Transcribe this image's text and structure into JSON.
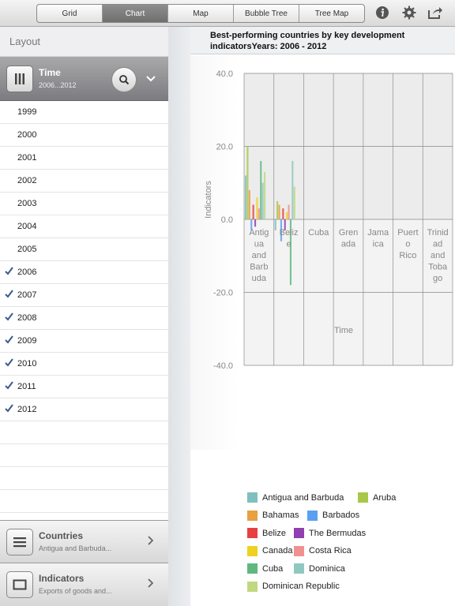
{
  "toolbar": {
    "tabs": [
      "Grid",
      "Chart",
      "Map",
      "Bubble Tree",
      "Tree Map"
    ],
    "active_tab": "Chart"
  },
  "sidebar": {
    "layout_label": "Layout",
    "time": {
      "title": "Time",
      "subtitle": "2006...2012"
    },
    "years": [
      {
        "label": "1999",
        "checked": false
      },
      {
        "label": "2000",
        "checked": false
      },
      {
        "label": "2001",
        "checked": false
      },
      {
        "label": "2002",
        "checked": false
      },
      {
        "label": "2003",
        "checked": false
      },
      {
        "label": "2004",
        "checked": false
      },
      {
        "label": "2005",
        "checked": false
      },
      {
        "label": "2006",
        "checked": true
      },
      {
        "label": "2007",
        "checked": true
      },
      {
        "label": "2008",
        "checked": true
      },
      {
        "label": "2009",
        "checked": true
      },
      {
        "label": "2010",
        "checked": true
      },
      {
        "label": "2011",
        "checked": true
      },
      {
        "label": "2012",
        "checked": true
      }
    ],
    "countries": {
      "title": "Countries",
      "subtitle": "Antigua and Barbuda..."
    },
    "indicators": {
      "title": "Indicators",
      "subtitle": "Exports of goods and..."
    }
  },
  "chart_data": {
    "type": "bar",
    "title": "Best-performing countries by key development indicatorsYears: 2006 - 2012",
    "xlabel": "Time",
    "ylabel": "Indicators",
    "ylim": [
      -40,
      40
    ],
    "yticks": [
      "40.0",
      "20.0",
      "0.0",
      "-20.0",
      "-40.0"
    ],
    "categories": [
      "Antigua and Barbuda",
      "Belize",
      "Cuba",
      "Grenada",
      "Jamaica",
      "Puerto Rico",
      "Trinidad and Tobago"
    ],
    "category_label_lines": [
      [
        "Antig",
        "ua",
        "and",
        "Barb",
        "uda"
      ],
      [
        "Beliz",
        "e"
      ],
      [
        "Cuba"
      ],
      [
        "Gren",
        "ada"
      ],
      [
        "Jama",
        "ica"
      ],
      [
        "Puert",
        "o",
        "Rico"
      ],
      [
        "Trinid",
        "ad",
        "and",
        "Toba",
        "go"
      ]
    ],
    "grid": true,
    "legend_position": "bottom",
    "series": [
      {
        "name": "Antigua and Barbuda",
        "color": "#7fbfbf",
        "values": [
          12,
          -3,
          0,
          0,
          0,
          0,
          0
        ]
      },
      {
        "name": "Aruba",
        "color": "#a8c84a",
        "values": [
          20,
          5,
          0,
          0,
          0,
          0,
          0
        ]
      },
      {
        "name": "Bahamas",
        "color": "#e8a040",
        "values": [
          8,
          4,
          0,
          0,
          0,
          0,
          0
        ]
      },
      {
        "name": "Barbados",
        "color": "#5aa0f0",
        "values": [
          -3,
          -6,
          0,
          0,
          0,
          0,
          0
        ]
      },
      {
        "name": "Belize",
        "color": "#e84040",
        "values": [
          4,
          3,
          0,
          0,
          0,
          0,
          0
        ]
      },
      {
        "name": "The Bermudas",
        "color": "#9040b0",
        "values": [
          -2,
          -3,
          0,
          0,
          0,
          0,
          0
        ]
      },
      {
        "name": "Canada",
        "color": "#f0d020",
        "values": [
          6,
          2,
          0,
          0,
          0,
          0,
          0
        ]
      },
      {
        "name": "Costa Rica",
        "color": "#f09090",
        "values": [
          3,
          4,
          0,
          0,
          0,
          0,
          0
        ]
      },
      {
        "name": "Cuba",
        "color": "#60b880",
        "values": [
          16,
          -18,
          0,
          0,
          0,
          0,
          0
        ]
      },
      {
        "name": "Dominica",
        "color": "#90c8c0",
        "values": [
          10,
          16,
          0,
          0,
          0,
          0,
          0
        ]
      },
      {
        "name": "Dominican Republic",
        "color": "#c0d880",
        "values": [
          13,
          9,
          0,
          0,
          0,
          0,
          0
        ]
      }
    ]
  }
}
